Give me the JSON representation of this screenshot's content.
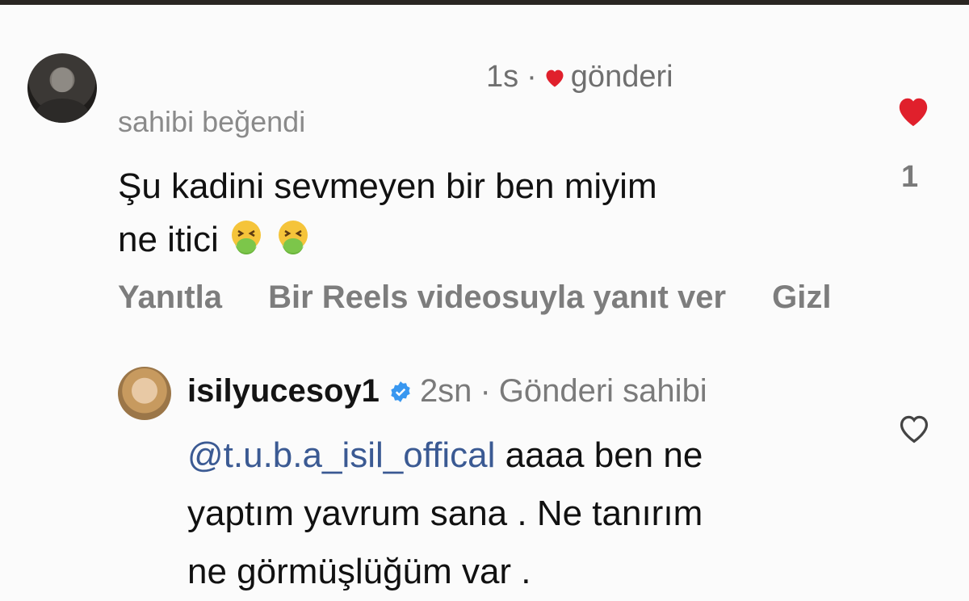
{
  "comment": {
    "time": "1s",
    "separator": "·",
    "liked_label": "gönderi",
    "owner_liked": "sahibi beğendi",
    "text_line1": "Şu kadini sevmeyen bir ben miyim",
    "text_line2": "ne itici",
    "emojis": [
      "nauseated-face-icon",
      "nauseated-face-icon"
    ],
    "like_count": "1",
    "like_color": "#e0202c"
  },
  "actions": {
    "reply": "Yanıtla",
    "reels_reply": "Bir Reels videosuyla yanıt ver",
    "hide": "Gizl"
  },
  "reply": {
    "username": "isilyucesoy1",
    "verified_color": "#3897f0",
    "time": "2sn",
    "separator": "·",
    "owner_label": "Gönderi sahibi",
    "mention": "@t.u.b.a_isil_offical",
    "text_rest_line1": "aaaa ben ne",
    "text_line2": "yaptım yavrum sana . Ne tanırım",
    "text_line3": "ne görmüşlüğüm var ."
  }
}
